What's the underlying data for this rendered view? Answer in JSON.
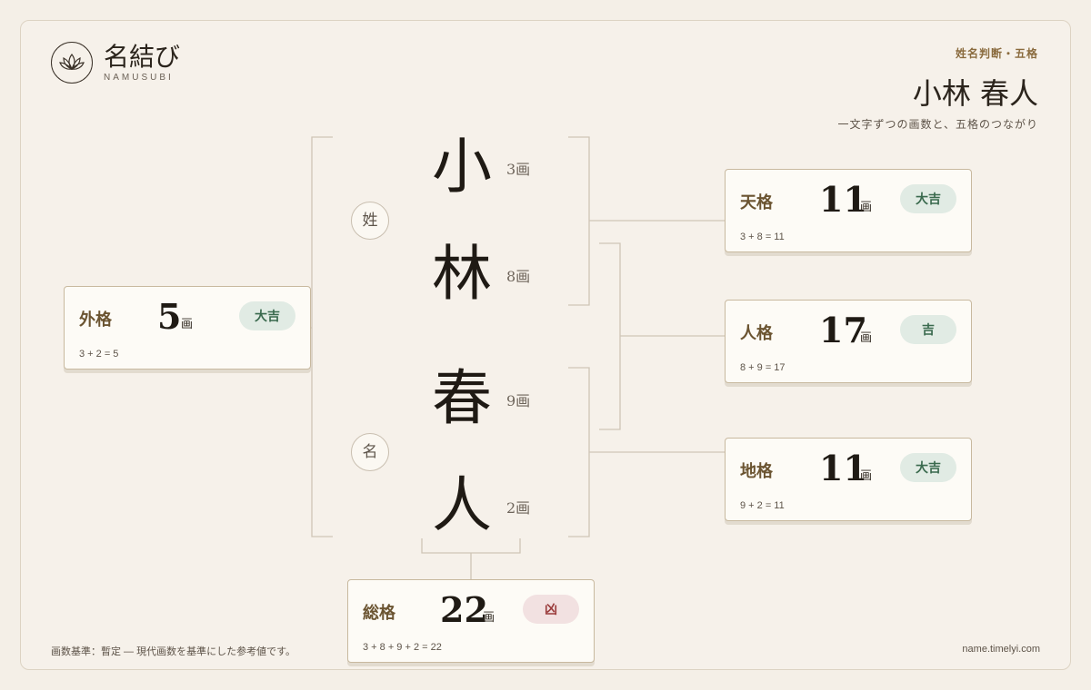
{
  "brand": {
    "title": "名結び",
    "subtitle": "NAMUSUBI",
    "icon": "lotus-icon"
  },
  "header": {
    "kicker": "姓名判断・五格",
    "name": "小林 春人",
    "description": "一文字ずつの画数と、五格のつながり"
  },
  "surname_role": "姓",
  "given_role": "名",
  "characters": [
    {
      "char": "小",
      "strokes": "3画"
    },
    {
      "char": "林",
      "strokes": "8画"
    },
    {
      "char": "春",
      "strokes": "9画"
    },
    {
      "char": "人",
      "strokes": "2画"
    }
  ],
  "unit": "画",
  "cards": {
    "gaikaku": {
      "label": "外格",
      "value": "5",
      "fortune": "大吉",
      "formula": "3 + 2 = 5"
    },
    "tenkaku": {
      "label": "天格",
      "value": "11",
      "fortune": "大吉",
      "formula": "3 + 8 = 11"
    },
    "jinkaku": {
      "label": "人格",
      "value": "17",
      "fortune": "吉",
      "formula": "8 + 9 = 17"
    },
    "chikaku": {
      "label": "地格",
      "value": "11",
      "fortune": "大吉",
      "formula": "9 + 2 = 11"
    },
    "soukaku": {
      "label": "総格",
      "value": "22",
      "fortune": "凶",
      "formula": "3 + 8 + 9 + 2 = 22"
    }
  },
  "colors": {
    "good_badge": "#e1ebe4",
    "bad_badge": "#f2e1e1",
    "accent": "#8a6b3e"
  },
  "footer": {
    "note": "画数基準：暫定 — 現代画数を基準にした参考値です。",
    "url": "name.timelyi.com"
  }
}
